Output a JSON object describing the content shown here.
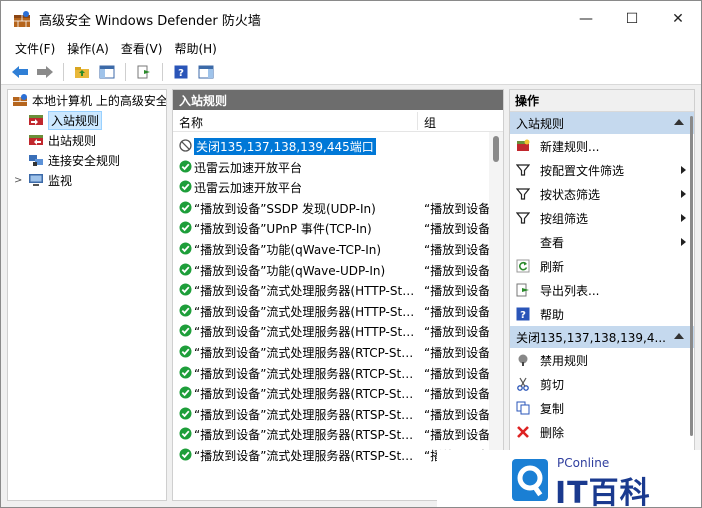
{
  "window": {
    "title": "高级安全 Windows Defender 防火墙",
    "minimize_glyph": "—",
    "maximize_glyph": "☐",
    "close_glyph": "✕"
  },
  "menu": [
    "文件(F)",
    "操作(A)",
    "查看(V)",
    "帮助(H)"
  ],
  "toolbar_icons": [
    "back-arrow-icon",
    "forward-arrow-icon",
    "folder-up-icon",
    "show-hide-pane-icon",
    "export-list-icon",
    "help-icon",
    "action-pane-icon"
  ],
  "tree": {
    "root": "本地计算机 上的高级安全",
    "items": [
      {
        "label": "入站规则",
        "icon": "inbound-rules-icon",
        "selected": true
      },
      {
        "label": "出站规则",
        "icon": "outbound-rules-icon",
        "selected": false
      },
      {
        "label": "连接安全规则",
        "icon": "connection-security-icon",
        "selected": false
      },
      {
        "label": "监视",
        "icon": "monitor-icon",
        "selected": false
      }
    ]
  },
  "middle": {
    "header": "入站规则",
    "columns": {
      "name": "名称",
      "group": "组"
    },
    "rows": [
      {
        "name": "关闭135,137,138,139,445端口",
        "group": "",
        "icon": "blocked-icon",
        "selected": true
      },
      {
        "name": "迅雷云加速开放平台",
        "group": "",
        "icon": "allowed-icon"
      },
      {
        "name": "迅雷云加速开放平台",
        "group": "",
        "icon": "allowed-icon"
      },
      {
        "name": "“播放到设备”SSDP 发现(UDP-In)",
        "group": "“播放到设备",
        "icon": "allowed-icon"
      },
      {
        "name": "“播放到设备”UPnP 事件(TCP-In)",
        "group": "“播放到设备",
        "icon": "allowed-icon"
      },
      {
        "name": "“播放到设备”功能(qWave-TCP-In)",
        "group": "“播放到设备",
        "icon": "allowed-icon"
      },
      {
        "name": "“播放到设备”功能(qWave-UDP-In)",
        "group": "“播放到设备",
        "icon": "allowed-icon"
      },
      {
        "name": "“播放到设备”流式处理服务器(HTTP-Stre...",
        "group": "“播放到设备",
        "icon": "allowed-icon"
      },
      {
        "name": "“播放到设备”流式处理服务器(HTTP-Stre...",
        "group": "“播放到设备",
        "icon": "allowed-icon"
      },
      {
        "name": "“播放到设备”流式处理服务器(HTTP-Stre...",
        "group": "“播放到设备",
        "icon": "allowed-icon"
      },
      {
        "name": "“播放到设备”流式处理服务器(RTCP-Stre...",
        "group": "“播放到设备",
        "icon": "allowed-icon"
      },
      {
        "name": "“播放到设备”流式处理服务器(RTCP-Stre...",
        "group": "“播放到设备",
        "icon": "allowed-icon"
      },
      {
        "name": "“播放到设备”流式处理服务器(RTCP-Stre...",
        "group": "“播放到设备",
        "icon": "allowed-icon"
      },
      {
        "name": "“播放到设备”流式处理服务器(RTSP-Stre...",
        "group": "“播放到设备",
        "icon": "allowed-icon"
      },
      {
        "name": "“播放到设备”流式处理服务器(RTSP-Stre...",
        "group": "“播放到设备",
        "icon": "allowed-icon"
      },
      {
        "name": "“播放到设备”流式处理服务器(RTSP-Stre...",
        "group": "“播放到设备",
        "icon": "allowed-icon"
      }
    ]
  },
  "actions": {
    "title": "操作",
    "section1": "入站规则",
    "section1_items": [
      {
        "label": "新建规则...",
        "icon": "new-rule-icon",
        "submenu": false
      },
      {
        "label": "按配置文件筛选",
        "icon": "filter-icon",
        "submenu": true
      },
      {
        "label": "按状态筛选",
        "icon": "filter-icon",
        "submenu": true
      },
      {
        "label": "按组筛选",
        "icon": "filter-icon",
        "submenu": true
      },
      {
        "label": "查看",
        "icon": "",
        "submenu": true
      },
      {
        "label": "刷新",
        "icon": "refresh-icon",
        "submenu": false
      },
      {
        "label": "导出列表...",
        "icon": "export-icon",
        "submenu": false
      },
      {
        "label": "帮助",
        "icon": "help-icon",
        "submenu": false
      }
    ],
    "section2": "关闭135,137,138,139,4...",
    "section2_items": [
      {
        "label": "禁用规则",
        "icon": "disable-icon"
      },
      {
        "label": "剪切",
        "icon": "cut-icon"
      },
      {
        "label": "复制",
        "icon": "copy-icon"
      },
      {
        "label": "删除",
        "icon": "delete-icon"
      }
    ]
  },
  "watermark": {
    "brand": "PConline",
    "big": "IT百科"
  },
  "colors": {
    "selected_row": "#0078d7",
    "pane_header": "#6d6d6d",
    "section_bg": "#c5d9ee",
    "allow_green": "#1e9e3a"
  }
}
